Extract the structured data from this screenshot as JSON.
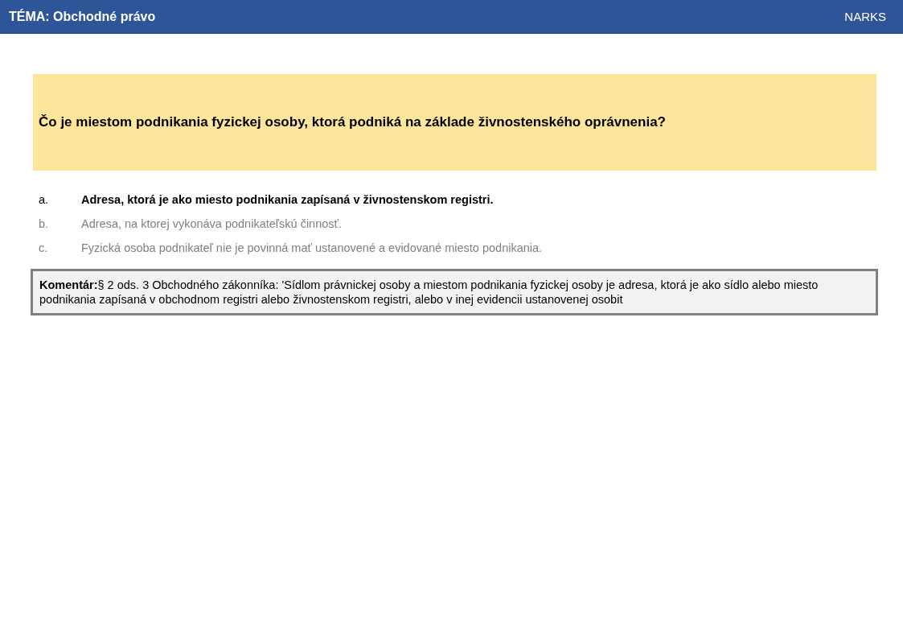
{
  "header": {
    "topic": "TÉMA: Obchodné právo",
    "brand": "NARKS"
  },
  "question": "Čo je miestom podnikania fyzickej osoby, ktorá podniká na základe živnostenského oprávnenia?",
  "answers": [
    {
      "letter": "a.",
      "text": "Adresa, ktorá je ako miesto podnikania zapísaná v živnostenskom registri.",
      "correct": true
    },
    {
      "letter": "b.",
      "text": "Adresa, na ktorej vykonáva podnikateľskú činnosť.",
      "correct": false
    },
    {
      "letter": "c.",
      "text": "Fyzická osoba podnikateľ nie je povinná mať ustanovené a evidované miesto podnikania.",
      "correct": false
    }
  ],
  "comment": "**Komentár:**§ 2 ods. 3 Obchodného zákonníka: 'Sídlom právnickej osoby a miestom podnikania fyzickej osoby je adresa, ktorá je ako sídlo alebo miesto podnikania zapísaná v obchodnom registri alebo živnostenskom registri, alebo v inej evidencii ustanovenej osobit"
}
